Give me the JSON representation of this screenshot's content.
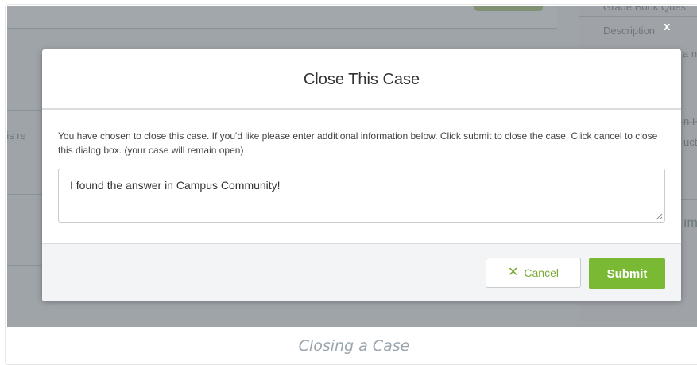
{
  "background": {
    "right_panel_fragments": [
      "Grade Book Ques",
      "Description",
      "a ne",
      "n Pro",
      "ucti",
      "ıme"
    ],
    "left_fragment": "his re"
  },
  "modal": {
    "close_label": "x",
    "title": "Close This Case",
    "description": "You have chosen to close this case. If you'd like please enter additional information below. Click submit to close the case. Click cancel to close this dialog box. (your case will remain open)",
    "note_value": "I found the answer in Campus Community!",
    "cancel_label": "Cancel",
    "submit_label": "Submit"
  },
  "caption": "Closing a Case",
  "colors": {
    "accent_green": "#7ab934",
    "overlay": "#283038"
  }
}
